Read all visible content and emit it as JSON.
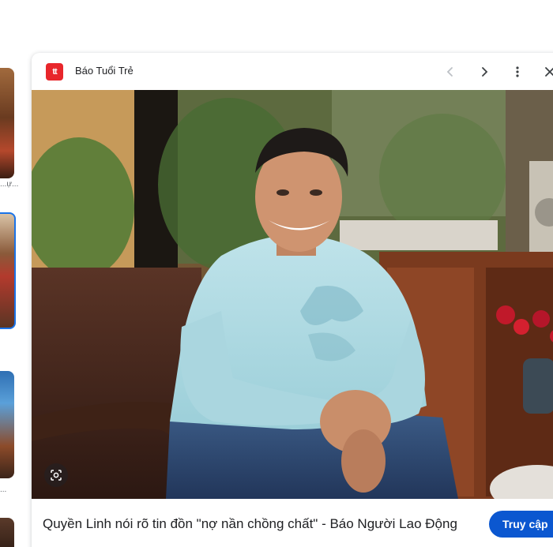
{
  "thumbnails": {
    "captions": [
      "...ự...",
      "..."
    ]
  },
  "preview": {
    "source_name": "Báo Tuổi Trẻ",
    "source_logo_text": "tt",
    "caption": "Quyền Linh nói rõ tin đồn \"nợ nần chồng chất\" - Báo Người Lao Động",
    "visit_label": "Truy cập",
    "visit_chevron": "›",
    "icons": {
      "prev": "chevron-left-icon",
      "next": "chevron-right-icon",
      "more": "more-vert-icon",
      "close": "close-icon",
      "lens": "google-lens-icon"
    },
    "colors": {
      "accent": "#0b57d0",
      "logo": "#e8262b",
      "selected_border": "#1a73e8"
    }
  }
}
